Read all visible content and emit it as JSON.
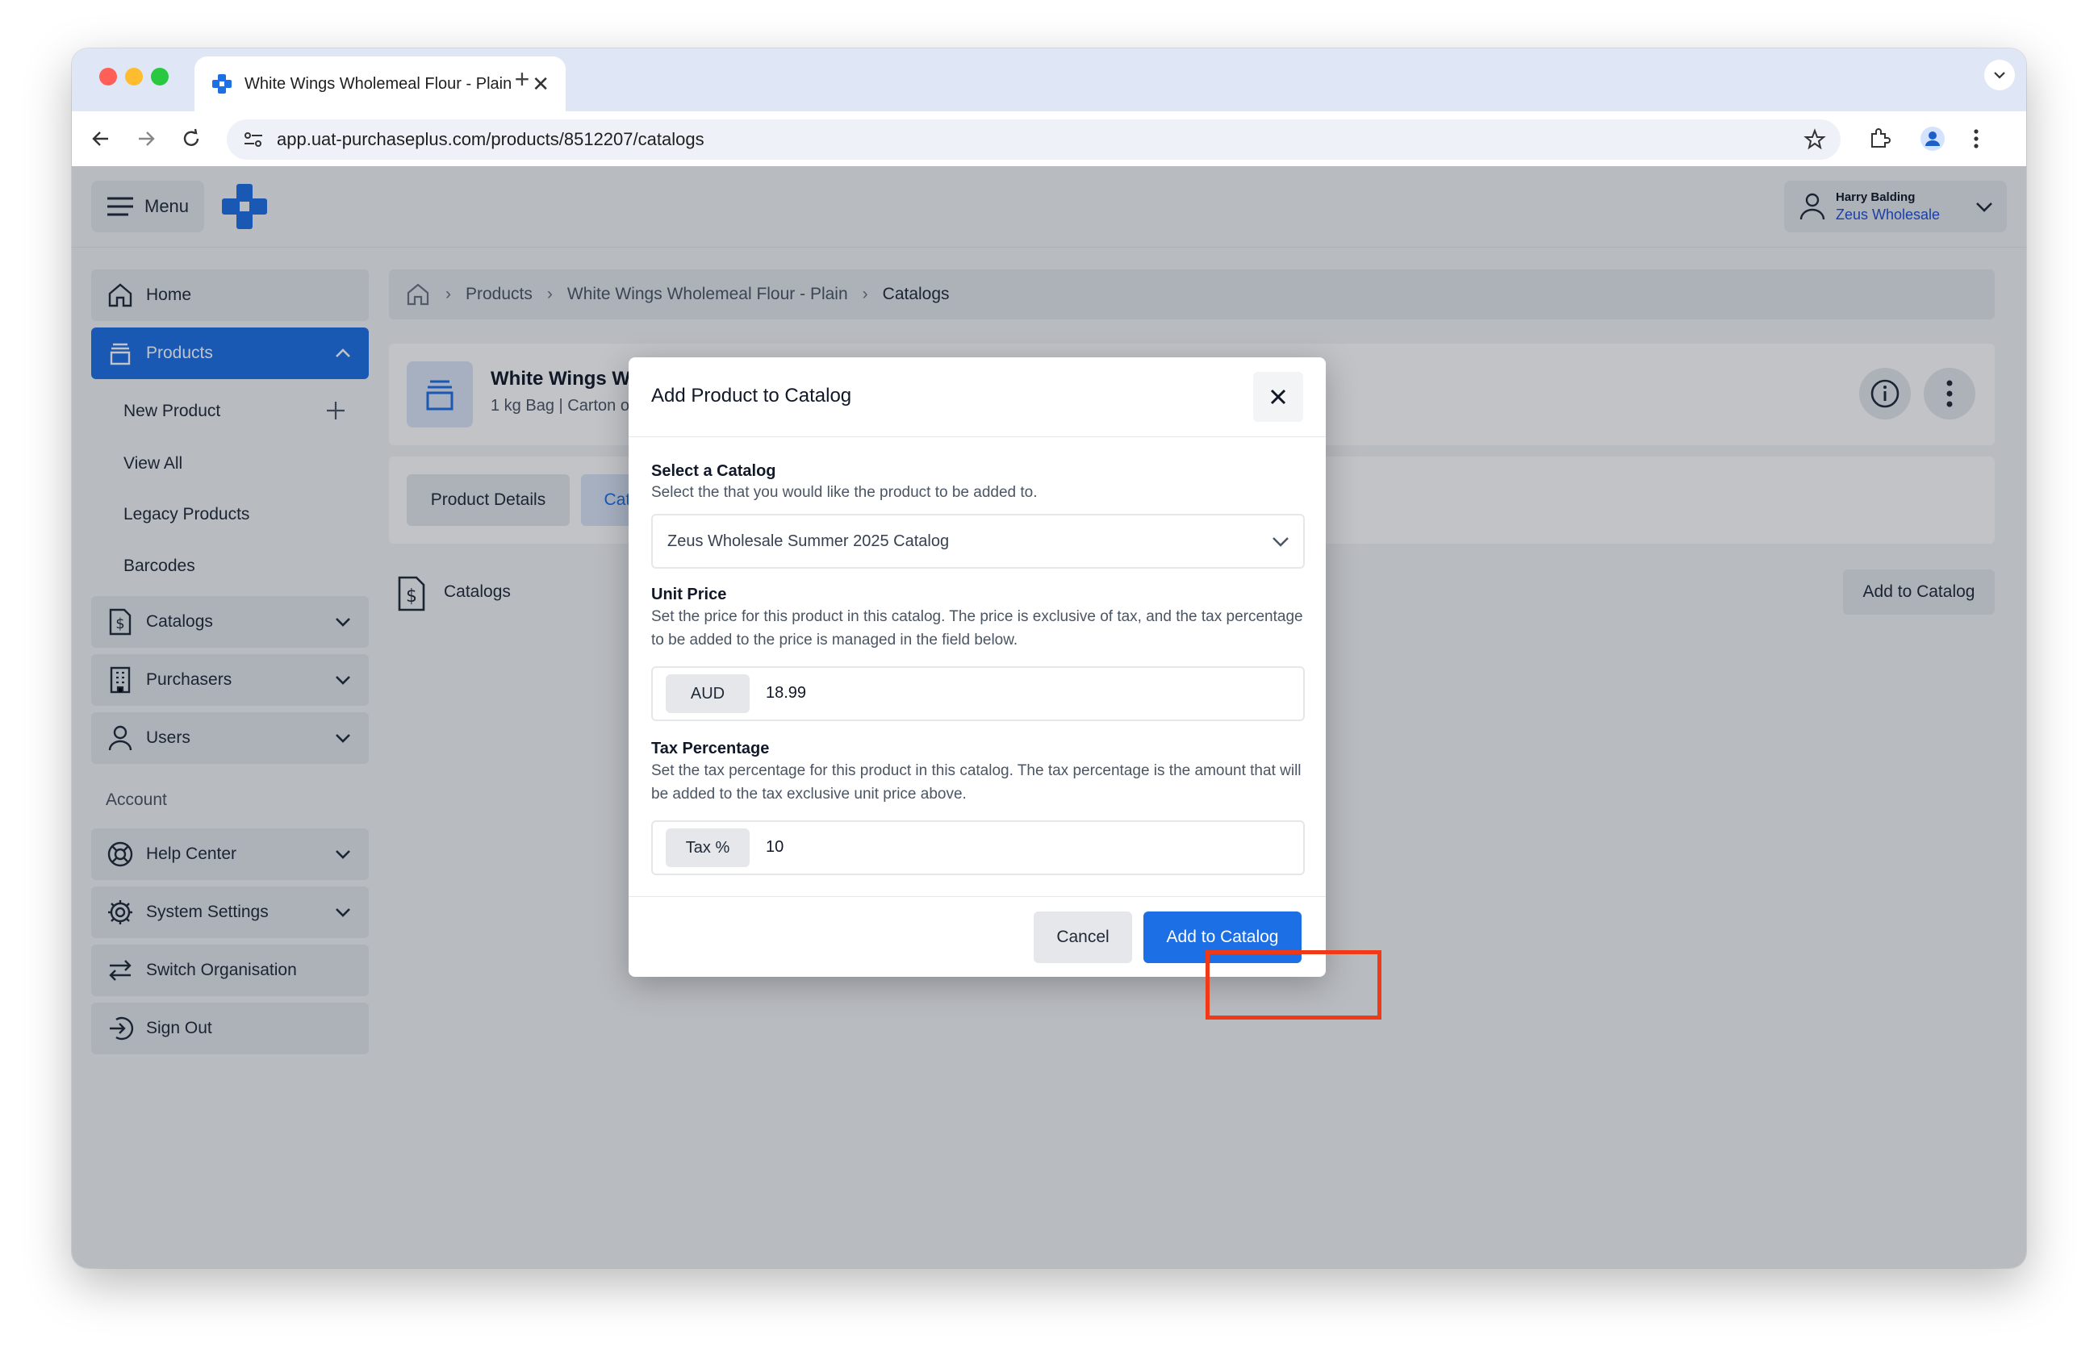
{
  "browser": {
    "tab_title": "White Wings Wholemeal Flour - Plain",
    "url": "app.uat-purchaseplus.com/products/8512207/catalogs"
  },
  "topbar": {
    "menu_label": "Menu",
    "user_name": "Harry Balding",
    "user_org": "Zeus Wholesale"
  },
  "sidebar": {
    "home": "Home",
    "products": "Products",
    "products_sub": [
      "New Product",
      "View All",
      "Legacy Products",
      "Barcodes"
    ],
    "catalogs": "Catalogs",
    "purchasers": "Purchasers",
    "users": "Users",
    "account_label": "Account",
    "help_center": "Help Center",
    "system_settings": "System Settings",
    "switch_org": "Switch Organisation",
    "sign_out": "Sign Out"
  },
  "breadcrumb": [
    "Products",
    "White Wings Wholemeal Flour - Plain",
    "Catalogs"
  ],
  "product": {
    "title": "White Wings Wholemeal Flour - Plain",
    "subtitle": "1 kg Bag | Carton of 24"
  },
  "product_tabs": [
    "Product Details",
    "Catalogs"
  ],
  "catalogs_section": {
    "label": "Catalogs",
    "add_button": "Add to Catalog"
  },
  "modal": {
    "title": "Add Product to Catalog",
    "select_label": "Select a Catalog",
    "select_desc": "Select the that you would like the product to be added to.",
    "select_value": "Zeus Wholesale Summer 2025 Catalog",
    "price_label": "Unit Price",
    "price_desc": "Set the price for this product in this catalog. The price is exclusive of tax, and the tax percentage to be added to the price is managed in the field below.",
    "price_currency": "AUD",
    "price_value": "18.99",
    "tax_label": "Tax Percentage",
    "tax_desc": "Set the tax percentage for this product in this catalog. The tax percentage is the amount that will be added to the tax exclusive unit price above.",
    "tax_addon": "Tax %",
    "tax_value": "10",
    "cancel": "Cancel",
    "submit": "Add to Catalog"
  },
  "colors": {
    "primary": "#1d6fe5",
    "highlight": "#f03a17"
  }
}
